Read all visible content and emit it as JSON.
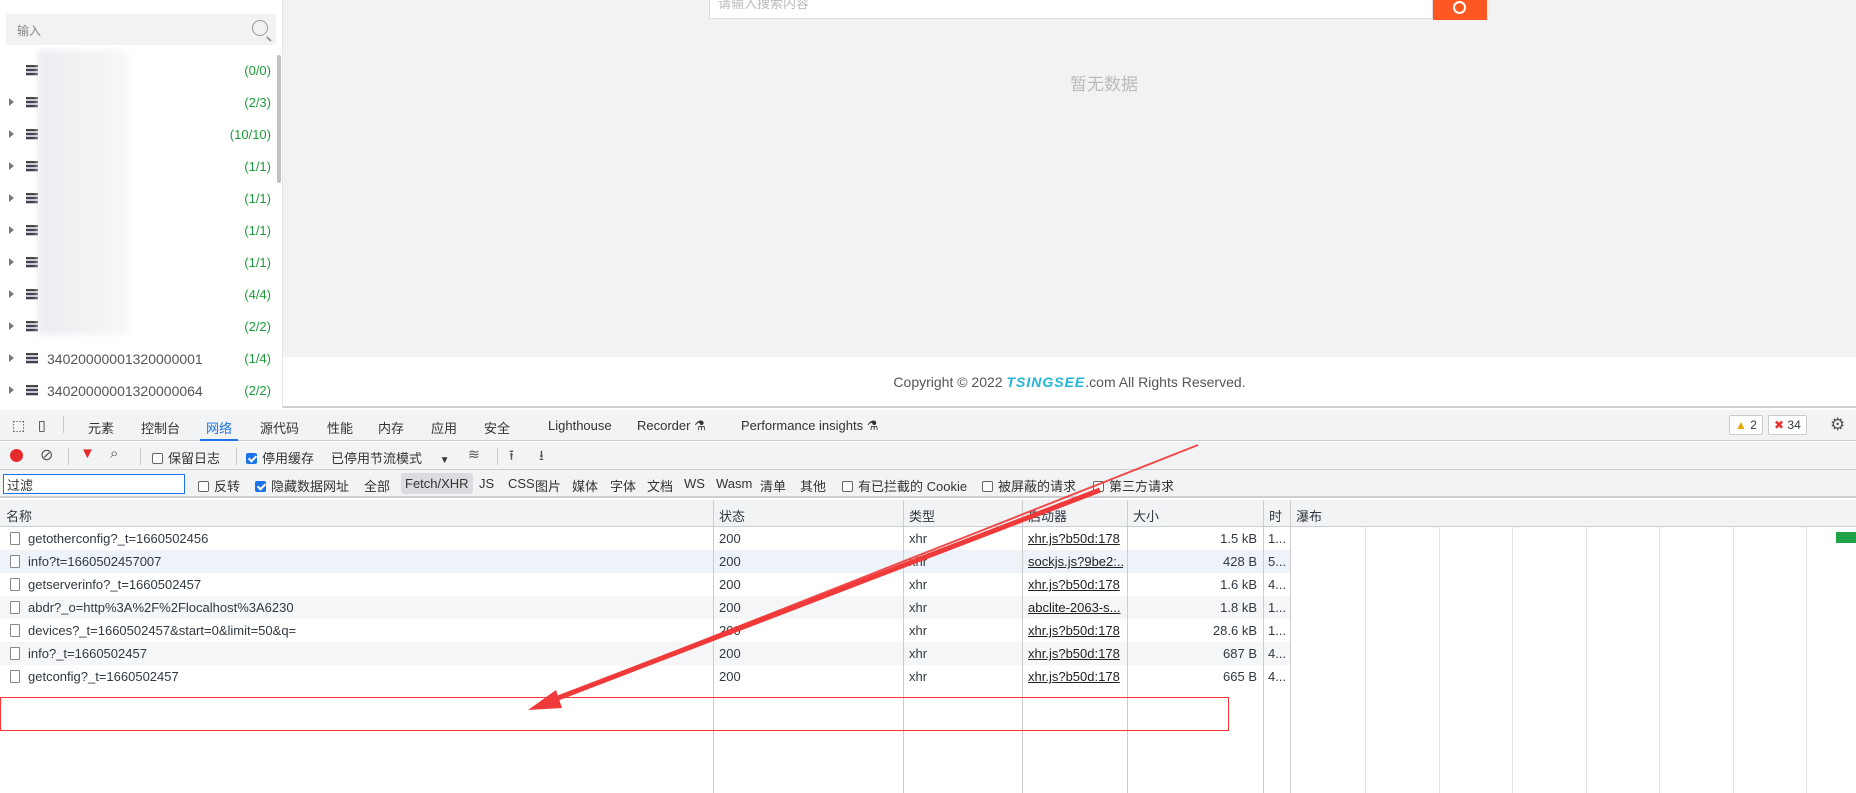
{
  "sidebar": {
    "search_placeholder": "输入",
    "items": [
      {
        "name": "",
        "count": "(0/0)",
        "expandable": false
      },
      {
        "name": "",
        "count": "(2/3)",
        "expandable": true
      },
      {
        "name": "",
        "count": "(10/10)",
        "expandable": true
      },
      {
        "name": "",
        "count": "(1/1)",
        "expandable": true
      },
      {
        "name": "",
        "count": "(1/1)",
        "expandable": true
      },
      {
        "name": "",
        "count": "(1/1)",
        "expandable": true
      },
      {
        "name": "",
        "count": "(1/1)",
        "expandable": true
      },
      {
        "name": "",
        "count": "(4/4)",
        "expandable": true
      },
      {
        "name": "",
        "count": "(2/2)",
        "expandable": true
      },
      {
        "name": "34020000001320000001",
        "count": "(1/4)",
        "expandable": true
      },
      {
        "name": "34020000001320000064",
        "count": "(2/2)",
        "expandable": true
      }
    ]
  },
  "main": {
    "search_placeholder": "请输入搜索内容",
    "empty_text": "暂无数据",
    "footer": {
      "prefix": "Copyright © 2022 ",
      "brand": "TSINGSEE",
      "suffix": ".com All Rights Reserved."
    },
    "accent": "#ff5722"
  },
  "devtools": {
    "tabs": [
      "元素",
      "控制台",
      "网络",
      "源代码",
      "性能",
      "内存",
      "应用",
      "安全",
      "Lighthouse",
      "Recorder ⚗",
      "Performance insights ⚗"
    ],
    "active_tab": "网络",
    "warnings": "2",
    "errors": "34",
    "toolbar": {
      "preserve_log": "保留日志",
      "disable_cache": "停用缓存",
      "throttle": "已停用节流模式"
    },
    "filter": {
      "placeholder": "过滤",
      "value": "过滤",
      "invert": "反转",
      "hide_data_urls": "隐藏数据网址",
      "types": [
        "全部",
        "Fetch/XHR",
        "JS",
        "CSS",
        "图片",
        "媒体",
        "字体",
        "文档",
        "WS",
        "Wasm",
        "清单",
        "其他"
      ],
      "active_type": "Fetch/XHR",
      "blocked_cookies": "有已拦截的 Cookie",
      "blocked_requests": "被屏蔽的请求",
      "third_party": "第三方请求"
    },
    "table": {
      "headers": [
        "名称",
        "状态",
        "类型",
        "启动器",
        "大小",
        "时",
        "瀑布"
      ],
      "rows": [
        {
          "name": "getotherconfig?_t=1660502456",
          "status": "200",
          "type": "xhr",
          "initiator": "xhr.js?b50d:178",
          "size": "1.5 kB",
          "time": "1..."
        },
        {
          "name": "info?t=1660502457007",
          "status": "200",
          "type": "xhr",
          "initiator": "sockjs.js?9be2:...",
          "size": "428 B",
          "time": "5..."
        },
        {
          "name": "getserverinfo?_t=1660502457",
          "status": "200",
          "type": "xhr",
          "initiator": "xhr.js?b50d:178",
          "size": "1.6 kB",
          "time": "4..."
        },
        {
          "name": "abdr?_o=http%3A%2F%2Flocalhost%3A6230",
          "status": "200",
          "type": "xhr",
          "initiator": "abclite-2063-s...",
          "size": "1.8 kB",
          "time": "1..."
        },
        {
          "name": "devices?_t=1660502457&start=0&limit=50&q=",
          "status": "200",
          "type": "xhr",
          "initiator": "xhr.js?b50d:178",
          "size": "28.6 kB",
          "time": "1..."
        },
        {
          "name": "info?_t=1660502457",
          "status": "200",
          "type": "xhr",
          "initiator": "xhr.js?b50d:178",
          "size": "687 B",
          "time": "4..."
        },
        {
          "name": "getconfig?_t=1660502457",
          "status": "200",
          "type": "xhr",
          "initiator": "xhr.js?b50d:178",
          "size": "665 B",
          "time": "4..."
        }
      ]
    }
  },
  "annotation_color": "#f03a3a"
}
